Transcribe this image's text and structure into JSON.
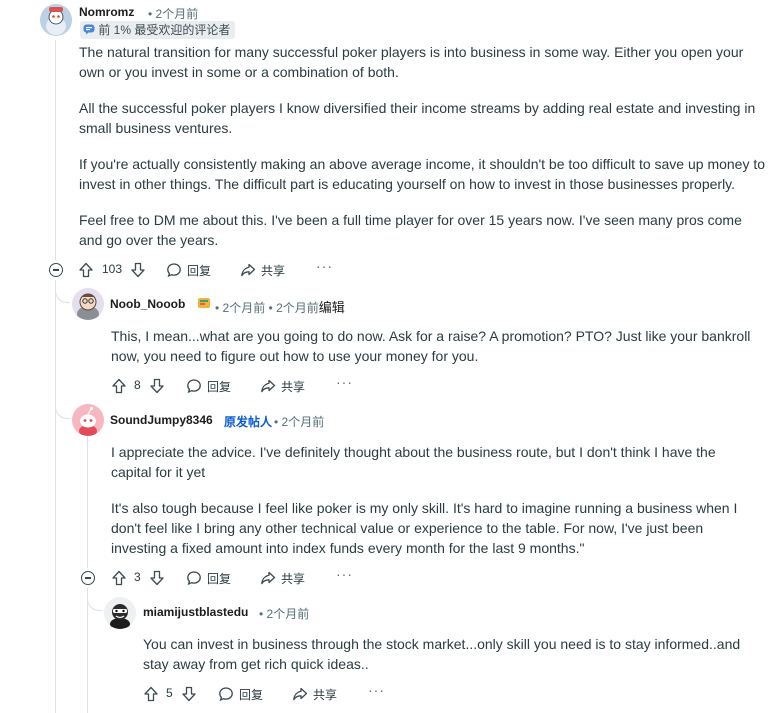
{
  "comments": [
    {
      "author": "Nomromz",
      "time": "• 2个月前",
      "flair": "前 1% 最受欢迎的评论者",
      "paragraphs": [
        "The natural transition for many successful poker players is into business in some way. Either you open your own or you invest in some or a combination of both.",
        "All the successful poker players I know diversified their income streams by adding real estate and investing in small business ventures.",
        "If you're actually consistently making an above average income, it shouldn't be too difficult to save up money to invest in other things. The difficult part is educating yourself on how to invest in those businesses properly.",
        "Feel free to DM me about this. I've been a full time player for over 15 years now. I've seen many pros come and go over the years."
      ],
      "score": "103",
      "reply_label": "回复",
      "share_label": "共享",
      "more_label": "···"
    },
    {
      "author": "Noob_Nooob",
      "time": "• 2个月前 • 2个月前",
      "edited": "编辑",
      "paragraphs": [
        "This, I mean...what are you going to do now. Ask for a raise? A promotion? PTO? Just like your bankroll now, you need to figure out how to use your money for you."
      ],
      "score": "8",
      "reply_label": "回复",
      "share_label": "共享",
      "more_label": "···"
    },
    {
      "author": "SoundJumpy8346",
      "op_badge": "原发帖人",
      "time": "• 2个月前",
      "paragraphs": [
        "I appreciate the advice. I've definitely thought about the business route, but I don't think I have the capital for it yet",
        "It's also tough because I feel like poker is my only skill. It's hard to imagine running a business when I don't feel like I bring any other technical value or experience to the table. For now, I've just been investing a fixed amount into index funds every month for the last 9 months.\""
      ],
      "score": "3",
      "reply_label": "回复",
      "share_label": "共享",
      "more_label": "···"
    },
    {
      "author": "miamijustblastedu",
      "time": "• 2个月前",
      "paragraphs": [
        "You can invest in business through the stock market...only skill you need is to stay informed..and stay away from get rich quick ideas.."
      ],
      "score": "5",
      "reply_label": "回复",
      "share_label": "共享",
      "more_label": "···"
    }
  ],
  "icons": {
    "upvote": "upvote-arrow-icon",
    "downvote": "downvote-arrow-icon",
    "reply": "speech-bubble-icon",
    "share": "share-arrow-icon",
    "collapse": "collapse-minus-icon",
    "flair": "chat-badge-icon",
    "user_badge": "snoovatar-badge-icon"
  },
  "colors": {
    "op_badge": "#0a5bd6",
    "meta_text": "#576f76",
    "body_text": "#2a3c42",
    "thread_line": "#dde1e6"
  }
}
